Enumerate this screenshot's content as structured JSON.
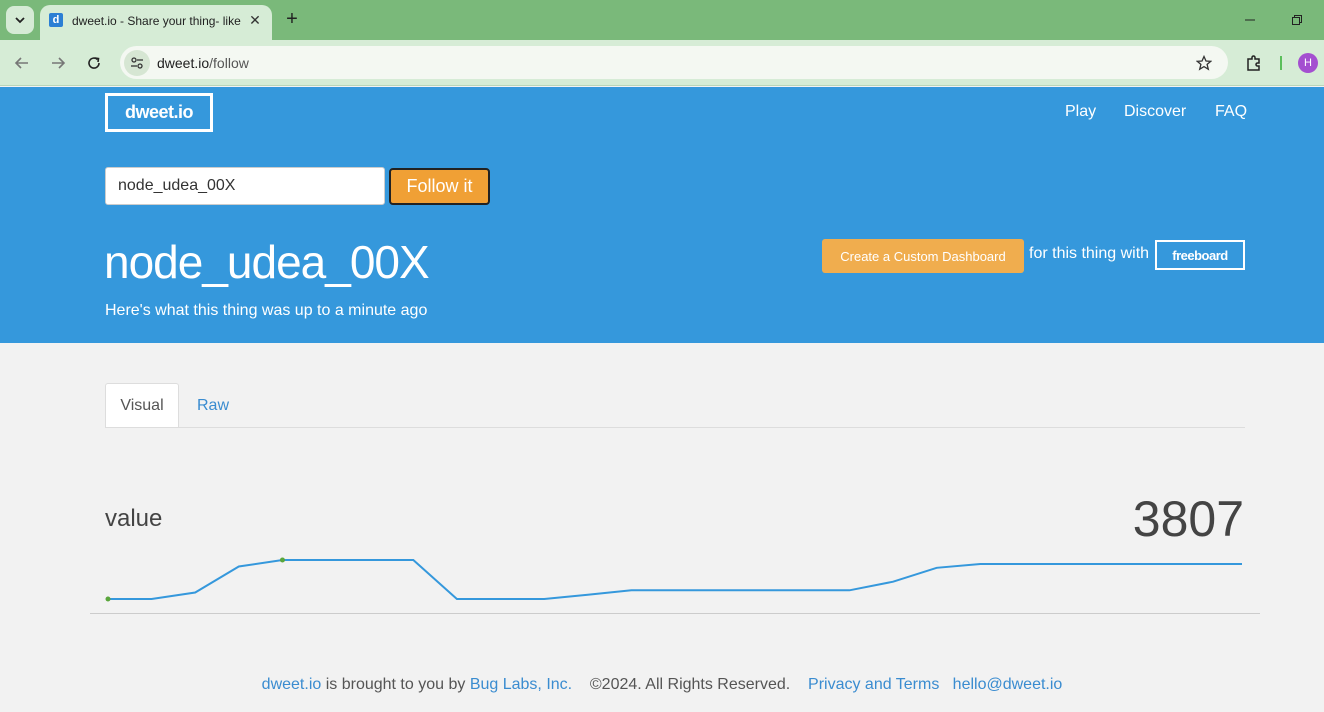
{
  "browser": {
    "tab_title": "dweet.io - Share your thing- like it ain't no thang.",
    "favicon_letter": "d",
    "url_host": "dweet.io",
    "url_path": "/follow",
    "profile_initial": "H"
  },
  "header": {
    "logo": "dweet.io",
    "nav": [
      "Play",
      "Discover",
      "FAQ"
    ],
    "thing_input_value": "node_udea_00X",
    "follow_button": "Follow it",
    "thing_title": "node_udea_00X",
    "subtitle": "Here's what this thing was up to a minute ago",
    "dashboard_button": "Create a Custom Dashboard",
    "dashboard_text": "for this thing with",
    "freeboard": "freeboard"
  },
  "tabs": [
    "Visual",
    "Raw"
  ],
  "metric": {
    "label": "value",
    "current": "3807"
  },
  "sparkline": [
    3000,
    3000,
    3150,
    3750,
    3900,
    3900,
    3900,
    3900,
    3000,
    3000,
    3000,
    3100,
    3200,
    3200,
    3200,
    3200,
    3200,
    3200,
    3400,
    3720,
    3807,
    3807,
    3807,
    3807,
    3807,
    3807,
    3807
  ],
  "footer": {
    "brand": "dweet.io",
    "brought": "is brought to you by",
    "company": "Bug Labs, Inc.",
    "copyright": "©2024. All Rights Reserved.",
    "privacy": "Privacy and Terms",
    "email": "hello@dweet.io"
  }
}
